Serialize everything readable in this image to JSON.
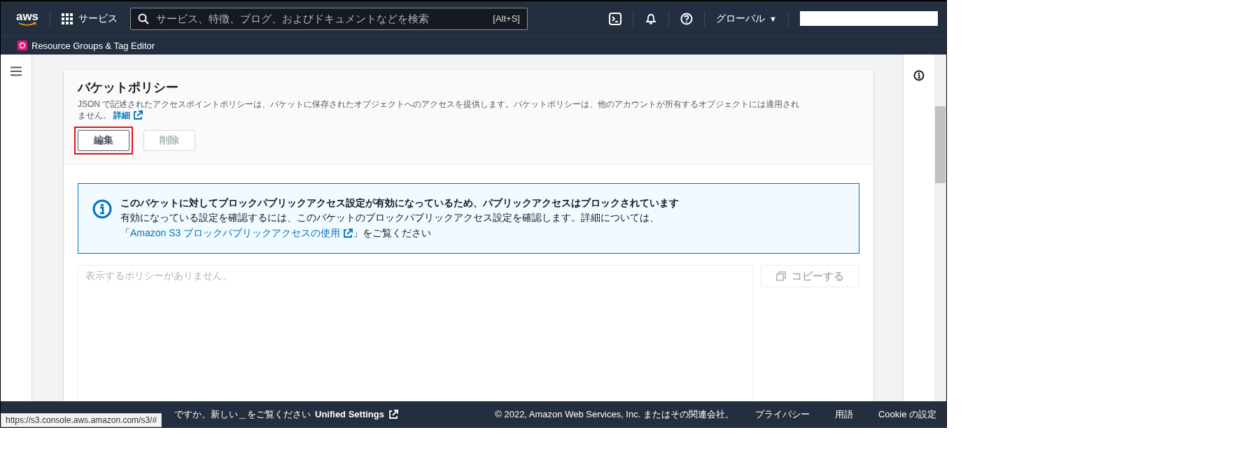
{
  "top_nav": {
    "logo": "aws",
    "services_label": "サービス",
    "search": {
      "placeholder": "サービス、特徴、ブログ、およびドキュメントなどを検索",
      "shortcut": "[Alt+S]"
    },
    "region": "グローバル",
    "region_caret": "▼"
  },
  "bookmark_bar": {
    "items": [
      {
        "label": "Resource Groups & Tag Editor"
      }
    ]
  },
  "policy_panel": {
    "title": "バケットポリシー",
    "description": "JSON で記述されたアクセスポイントポリシーは、バケットに保存されたオブジェクトへのアクセスを提供します。バケットポリシーは、他のアカウントが所有するオブジェクトには適用されません。",
    "learn_more": "詳細",
    "buttons": [
      {
        "label": "編集",
        "disabled": false,
        "highlighted": true
      },
      {
        "label": "削除",
        "disabled": true,
        "highlighted": false
      }
    ]
  },
  "alert": {
    "kind": "info",
    "title": "このバケットに対してブロックパブリックアクセス設定が有効になっているため、パブリックアクセスはブロックされています",
    "body_prefix": "有効になっている設定を確認するには、このバケットのブロックパブリックアクセス設定を確認します。詳細については、「",
    "link": "Amazon S3 ブロックパブリックアクセスの使用",
    "body_suffix": "」をご覧ください"
  },
  "policy_editor": {
    "placeholder": "表示するポリシーがありません。",
    "copy_button": {
      "label": "コピーする",
      "disabled": true
    }
  },
  "footer": {
    "feedback_text": "ですか。新しい＿をご覧ください",
    "unified_settings": "Unified Settings",
    "copyright": "© 2022, Amazon Web Services, Inc. またはその関連会社。",
    "links": [
      "プライバシー",
      "用語",
      "Cookie の設定"
    ]
  },
  "status_url": "https://s3.console.aws.amazon.com/s3/#"
}
